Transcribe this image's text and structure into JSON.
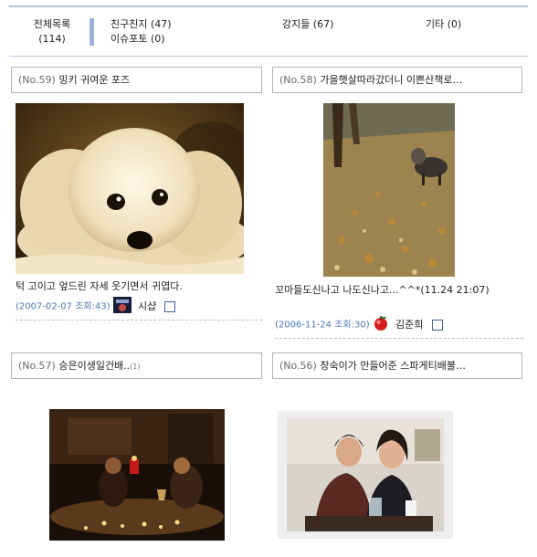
{
  "categories": {
    "all": "전체목록",
    "all_count": "(114)",
    "friends": "친구친지 (47)",
    "issue": "이슈포토 (0)",
    "dogs": "강지들 (67)",
    "other": "기타 (0)"
  },
  "posts": [
    {
      "num": "(No.59)",
      "title": "밍키 귀여운 포즈",
      "desc": "턱 고이고 엎드린 자세 웃기면서 귀엽다.",
      "date": "(2007-02-07 조회:43)",
      "author": "시샵",
      "photo_icon": "white-maltese-dog-photo"
    },
    {
      "num": "(No.58)",
      "title": "가을햇살따라갔더니 이쁜산책로…",
      "desc": "꼬마들도신나고 나도신나고...^^*(11.24 21:07)",
      "date": "(2006-11-24 조회:30)",
      "author": "김준희",
      "photo_icon": "dog-on-autumn-leaves-photo"
    },
    {
      "num": "(No.57)",
      "title": "승은이생일건배..",
      "comment_count": "(1)",
      "photo_icon": "candlelight-dinner-photo"
    },
    {
      "num": "(No.56)",
      "title": "창숙이가 만들어준 스파게티배불…",
      "photo_icon": "two-women-portrait-photo"
    }
  ]
}
